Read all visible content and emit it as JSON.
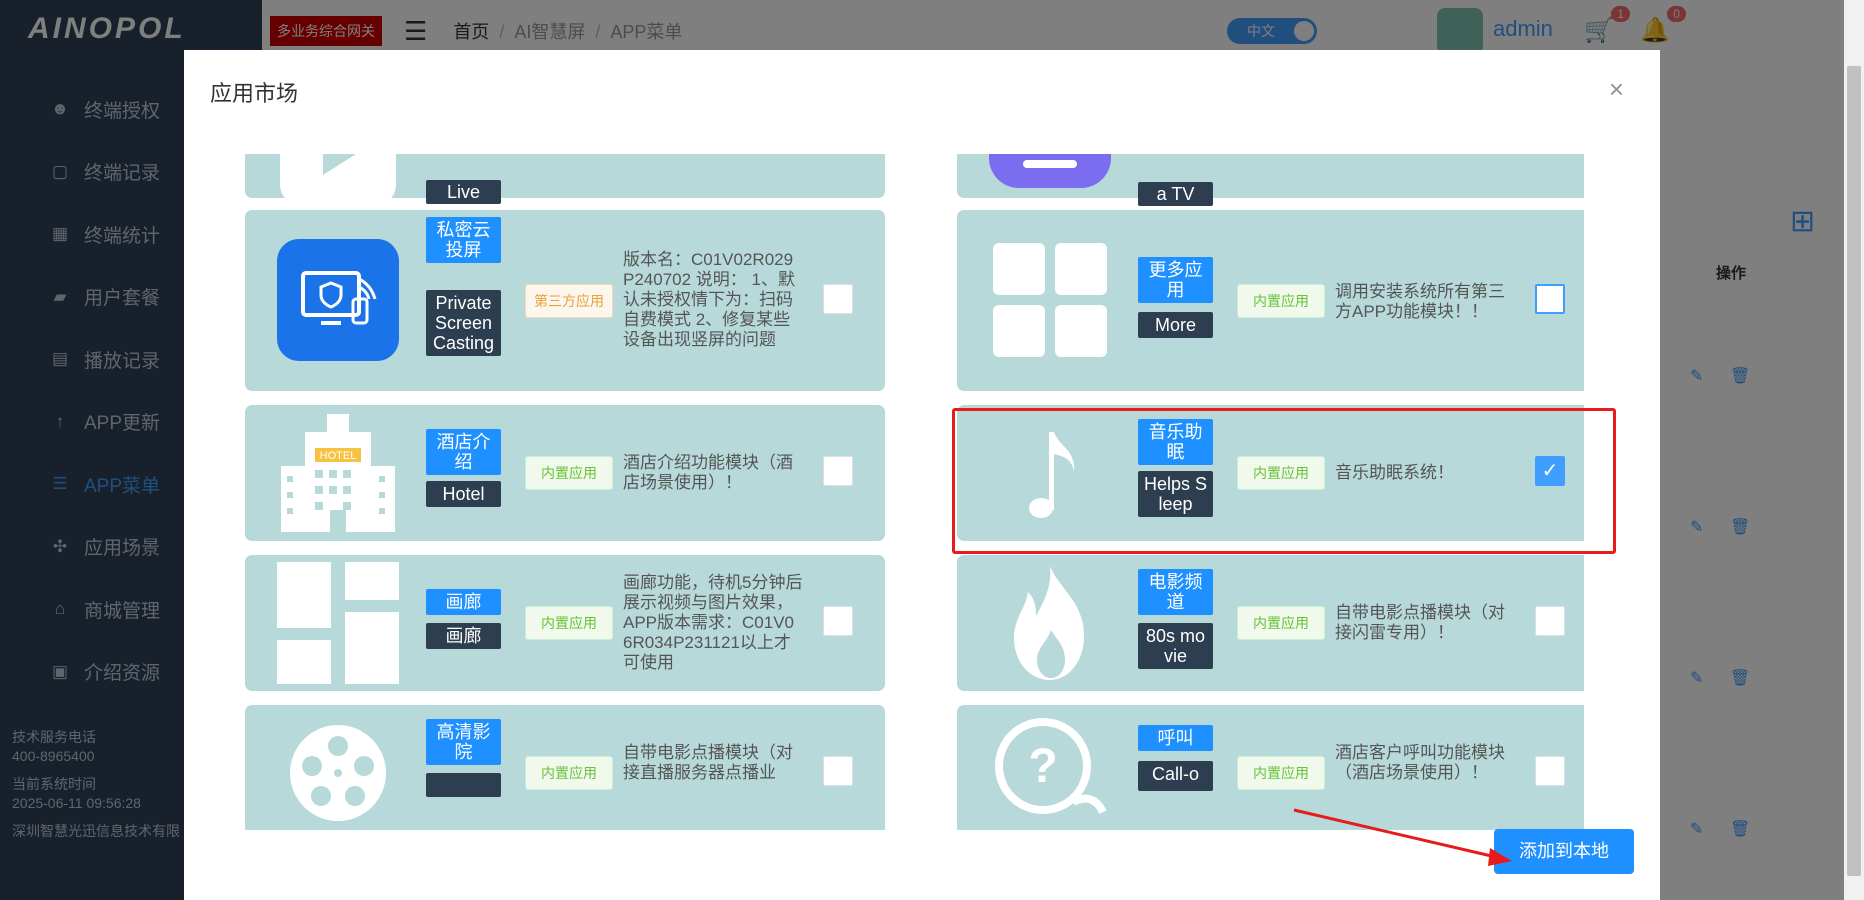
{
  "sidebar": {
    "logo": "AINOPOL",
    "items": [
      {
        "label": "终端授权",
        "icon": "robot-icon"
      },
      {
        "label": "终端记录",
        "icon": "file-icon"
      },
      {
        "label": "终端统计",
        "icon": "calendar-icon"
      },
      {
        "label": "用户套餐",
        "icon": "wallet-icon"
      },
      {
        "label": "播放记录",
        "icon": "document-icon"
      },
      {
        "label": "APP更新",
        "icon": "arrow-up-icon"
      },
      {
        "label": "APP菜单",
        "icon": "list-icon"
      },
      {
        "label": "应用场景",
        "icon": "pinwheel-icon"
      },
      {
        "label": "商城管理",
        "icon": "basket-icon"
      },
      {
        "label": "介绍资源",
        "icon": "id-card-icon"
      }
    ],
    "footer": {
      "phone_label": "技术服务电话",
      "phone": "400-8965400",
      "time_label": "当前系统时间",
      "time": "2025-06-11 09:56:28",
      "company": "深圳智慧光迅信息技术有限"
    }
  },
  "topbar": {
    "gateway_badge": "多业务综合网关",
    "breadcrumb": [
      "首页",
      "AI智慧屏",
      "APP菜单"
    ],
    "lang": "中文",
    "cart_count": "1",
    "bell_count": "0",
    "username": "admin"
  },
  "background": {
    "ops_header": "操作"
  },
  "modal": {
    "title": "应用市场",
    "add_button": "添加到本地",
    "cards_left": [
      {
        "cn": "",
        "en": "Live",
        "tag": "",
        "desc": "",
        "checked": false
      },
      {
        "cn": "私密云投屏",
        "en": "PrivateScreenCasting",
        "tag": "第三方应用",
        "desc": "版本名：C01V02R029P240702 说明： 1、默认未授权情下为：扫码自费模式 2、修复某些设备出现竖屏的问题",
        "checked": false
      },
      {
        "cn": "酒店介绍",
        "en": "Hotel",
        "tag": "内置应用",
        "desc": "酒店介绍功能模块（酒店场景使用）！",
        "checked": false
      },
      {
        "cn": "画廊",
        "en": "画廊",
        "tag": "内置应用",
        "desc": "画廊功能，待机5分钟后展示视频与图片效果，APP版本需求：C01V06R034P231121以上才可使用",
        "checked": false
      },
      {
        "cn": "高清影院",
        "en": "",
        "tag": "内置应用",
        "desc": "自带电影点播模块（对接直播服务器点播业",
        "checked": false
      }
    ],
    "cards_right": [
      {
        "cn": "",
        "en": "a TV",
        "tag": "",
        "desc": "",
        "checked": false
      },
      {
        "cn": "更多应用",
        "en": "More",
        "tag": "内置应用",
        "desc": "调用安装系统所有第三方APP功能模块！！",
        "checked": false
      },
      {
        "cn": "音乐助眠",
        "en": "Helps Sleep",
        "tag": "内置应用",
        "desc": "音乐助眠系统！",
        "checked": true
      },
      {
        "cn": "电影频道",
        "en": "80s movie",
        "tag": "内置应用",
        "desc": "自带电影点播模块（对接闪雷专用）！",
        "checked": false
      },
      {
        "cn": "呼叫",
        "en": "Call-o",
        "tag": "内置应用",
        "desc": "酒店客户呼叫功能模块（酒店场景使用）！",
        "checked": false
      }
    ]
  }
}
